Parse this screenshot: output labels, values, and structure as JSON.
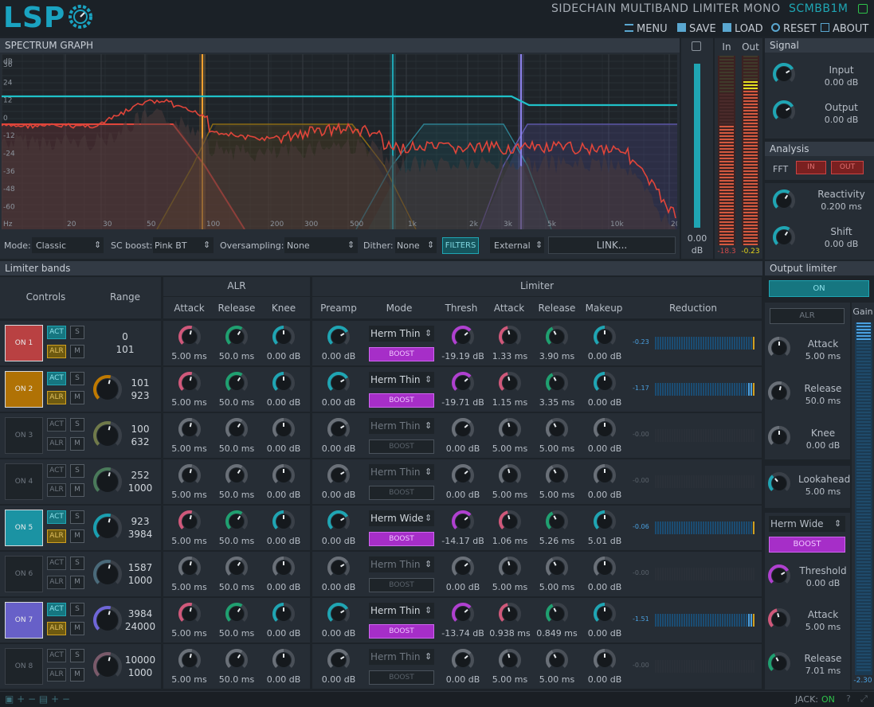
{
  "app": {
    "logo": "LSP",
    "title": "SIDECHAIN MULTIBAND LIMITER MONO",
    "code": "SCMBB1M"
  },
  "menu": [
    {
      "label": "MENU",
      "icon": "menu-icon"
    },
    {
      "label": "SAVE",
      "icon": "save-icon"
    },
    {
      "label": "LOAD",
      "icon": "load-icon"
    },
    {
      "label": "RESET",
      "icon": "reset-icon"
    },
    {
      "label": "ABOUT",
      "icon": "about-icon"
    }
  ],
  "spectrum": {
    "title": "SPECTRUM GRAPH",
    "unit": "dB",
    "y_ticks": [
      "36",
      "24",
      "12",
      "0",
      "-12",
      "-24",
      "-36",
      "-48",
      "-60"
    ],
    "x_ticks": [
      "Hz",
      "20",
      "30",
      "50",
      "100",
      "200",
      "300",
      "500",
      "1k",
      "2k",
      "3k",
      "5k",
      "10k",
      "20k"
    ]
  },
  "controls": {
    "mode_label": "Mode:",
    "mode": "Classic",
    "scboost_label": "SC boost:",
    "scboost": "Pink BT",
    "overs_label": "Oversampling:",
    "overs": "None",
    "dither_label": "Dither:",
    "dither": "None",
    "filters": "FILTERS",
    "source": "External",
    "link": "LINK..."
  },
  "meter_io": {
    "in_label": "In",
    "out_label": "Out",
    "in_val": "-18.3",
    "out_val": "-0.23",
    "zoom_val": "0.00",
    "zoom_unit": "dB"
  },
  "signal": {
    "title": "Signal",
    "input_label": "Input",
    "input_val": "0.00 dB",
    "output_label": "Output",
    "output_val": "0.00 dB"
  },
  "analysis": {
    "title": "Analysis",
    "fft": "FFT",
    "in": "IN",
    "out": "OUT",
    "react_label": "Reactivity",
    "react_val": "0.200 ms",
    "shift_label": "Shift",
    "shift_val": "0.00 dB"
  },
  "bands_title": "Limiter bands",
  "headers": {
    "controls": "Controls",
    "range": "Range",
    "alr": "ALR",
    "limiter": "Limiter",
    "attack": "Attack",
    "release": "Release",
    "knee": "Knee",
    "preamp": "Preamp",
    "mode": "Mode",
    "thresh": "Thresh",
    "makeup": "Makeup",
    "reduction": "Reduction"
  },
  "btn": {
    "act": "ACT",
    "alr": "ALR",
    "s": "S",
    "m": "M",
    "boost": "BOOST"
  },
  "bands": [
    {
      "on": "ON 1",
      "active": true,
      "color": "#c94444",
      "r1": "0",
      "r2": "101",
      "alr_a": "5.00 ms",
      "alr_r": "50.0 ms",
      "alr_k": "0.00 dB",
      "pre": "0.00 dB",
      "mode": "Herm Thin",
      "thr": "-19.19 dB",
      "att": "1.33 ms",
      "rel": "3.90 ms",
      "mk": "0.00 dB",
      "red": "-0.23"
    },
    {
      "on": "ON 2",
      "active": true,
      "color": "#c07a00",
      "r1": "101",
      "r2": "923",
      "alr_a": "5.00 ms",
      "alr_r": "50.0 ms",
      "alr_k": "0.00 dB",
      "pre": "0.00 dB",
      "mode": "Herm Thin",
      "thr": "-19.71 dB",
      "att": "1.15 ms",
      "rel": "3.35 ms",
      "mk": "0.00 dB",
      "red": "-1.17"
    },
    {
      "on": "ON 3",
      "active": false,
      "color": "#707a4a",
      "r1": "100",
      "r2": "632",
      "alr_a": "5.00 ms",
      "alr_r": "50.0 ms",
      "alr_k": "0.00 dB",
      "pre": "0.00 dB",
      "mode": "Herm Thin",
      "thr": "0.00 dB",
      "att": "5.00 ms",
      "rel": "5.00 ms",
      "mk": "0.00 dB",
      "red": "-0.00"
    },
    {
      "on": "ON 4",
      "active": false,
      "color": "#4a7a5a",
      "r1": "252",
      "r2": "1000",
      "alr_a": "5.00 ms",
      "alr_r": "50.0 ms",
      "alr_k": "0.00 dB",
      "pre": "0.00 dB",
      "mode": "Herm Thin",
      "thr": "0.00 dB",
      "att": "5.00 ms",
      "rel": "5.00 ms",
      "mk": "0.00 dB",
      "red": "-0.00"
    },
    {
      "on": "ON 5",
      "active": true,
      "color": "#1a9fb0",
      "r1": "923",
      "r2": "3984",
      "alr_a": "5.00 ms",
      "alr_r": "50.0 ms",
      "alr_k": "0.00 dB",
      "pre": "0.00 dB",
      "mode": "Herm Wide",
      "thr": "-14.17 dB",
      "att": "1.06 ms",
      "rel": "5.26 ms",
      "mk": "5.01 dB",
      "red": "-0.06"
    },
    {
      "on": "ON 6",
      "active": false,
      "color": "#4a6a7a",
      "r1": "1587",
      "r2": "1000",
      "alr_a": "5.00 ms",
      "alr_r": "50.0 ms",
      "alr_k": "0.00 dB",
      "pre": "0.00 dB",
      "mode": "Herm Thin",
      "thr": "0.00 dB",
      "att": "5.00 ms",
      "rel": "5.00 ms",
      "mk": "0.00 dB",
      "red": "-0.00"
    },
    {
      "on": "ON 7",
      "active": true,
      "color": "#6f66d8",
      "r1": "3984",
      "r2": "24000",
      "alr_a": "5.00 ms",
      "alr_r": "50.0 ms",
      "alr_k": "0.00 dB",
      "pre": "0.00 dB",
      "mode": "Herm Thin",
      "thr": "-13.74 dB",
      "att": "0.938 ms",
      "rel": "0.849 ms",
      "mk": "0.00 dB",
      "red": "-1.51"
    },
    {
      "on": "ON 8",
      "active": false,
      "color": "#7a5a6a",
      "r1": "10000",
      "r2": "1000",
      "alr_a": "5.00 ms",
      "alr_r": "50.0 ms",
      "alr_k": "0.00 dB",
      "pre": "0.00 dB",
      "mode": "Herm Thin",
      "thr": "0.00 dB",
      "att": "5.00 ms",
      "rel": "5.00 ms",
      "mk": "0.00 dB",
      "red": "-0.00"
    }
  ],
  "output_limiter": {
    "title": "Output limiter",
    "on": "ON",
    "alr": "ALR",
    "attack_label": "Attack",
    "attack": "5.00 ms",
    "release_label": "Release",
    "release": "50.0 ms",
    "knee_label": "Knee",
    "knee": "0.00 dB",
    "look_label": "Lookahead",
    "look": "5.00 ms",
    "mode": "Herm Wide",
    "boost": "BOOST",
    "thr_label": "Threshold",
    "thr": "0.00 dB",
    "att2_label": "Attack",
    "att2": "5.00 ms",
    "rel2_label": "Release",
    "rel2": "7.01 ms",
    "gain_label": "Gain",
    "gain_val": "-2.30"
  },
  "status": {
    "jack_label": "JACK:",
    "jack": "ON"
  },
  "colors": {
    "accent": "#1fa5b3",
    "alr_attack": "#d0587a",
    "alr_release": "#1fa070",
    "knee": "#1fa5b3",
    "thresh": "#b040d0",
    "boost": "#a62ec8"
  }
}
